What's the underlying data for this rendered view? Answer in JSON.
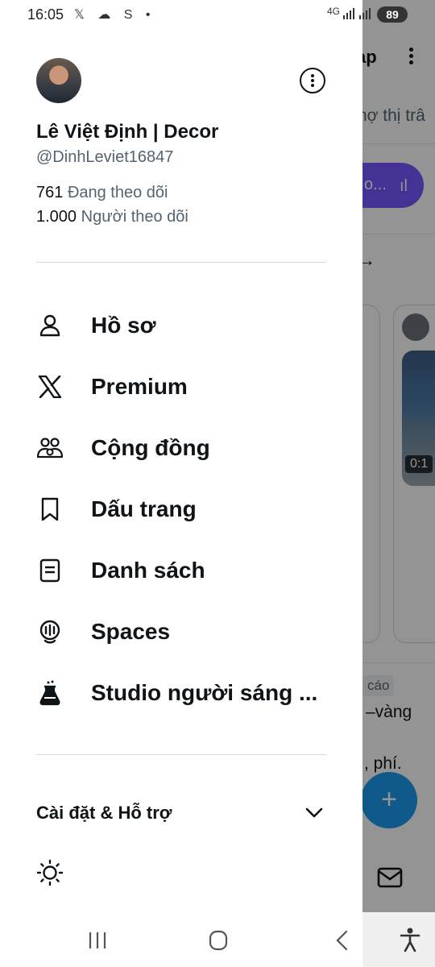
{
  "status_bar": {
    "time": "16:05",
    "left_icons": "𝕏 ☁ S •",
    "network": "4G",
    "battery": "89"
  },
  "background": {
    "header_fragment": "ạp",
    "tab_fragment": "nợ thị trâ",
    "pill_fragment": "o...",
    "video_duration": "0:1",
    "ad_tag": "cáo",
    "text_fragment_1": "–vàng",
    "text_fragment_2": ", phí."
  },
  "profile": {
    "name": "Lê Việt Định | Decor",
    "handle": "@DinhLeviet16847",
    "following_count": "761",
    "following_label": "Đang theo dõi",
    "followers_count": "1.000",
    "followers_label": "Người theo dõi"
  },
  "menu": {
    "items": [
      {
        "label": "Hồ sơ",
        "icon": "profile-icon"
      },
      {
        "label": "Premium",
        "icon": "x-logo-icon"
      },
      {
        "label": "Cộng đồng",
        "icon": "communities-icon"
      },
      {
        "label": "Dấu trang",
        "icon": "bookmark-icon"
      },
      {
        "label": "Danh sách",
        "icon": "lists-icon"
      },
      {
        "label": "Spaces",
        "icon": "spaces-icon"
      },
      {
        "label": "Studio người sáng ...",
        "icon": "creator-studio-icon"
      }
    ]
  },
  "settings": {
    "label": "Cài đặt & Hỗ trợ"
  },
  "colors": {
    "text": "#0f1419",
    "secondary": "#536471",
    "accent": "#1d9bf0",
    "spaces_purple": "#7856ff"
  }
}
